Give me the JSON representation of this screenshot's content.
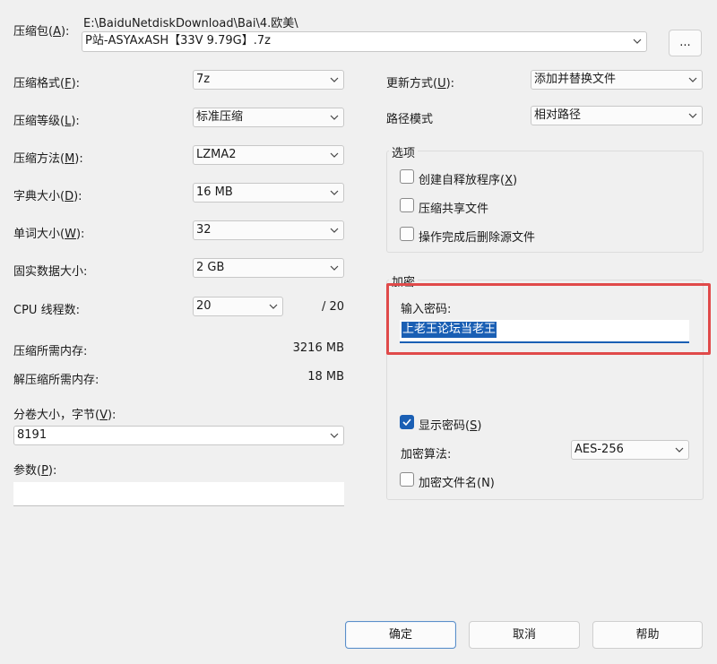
{
  "archive": {
    "label": "压缩包(",
    "accel": "A",
    "label_end": "):",
    "path": "E:\\BaiduNetdiskDownload\\Bai\\4.欧美\\",
    "filename": "P站-ASYAxASH【33V 9.79G】.7z",
    "browse_label": "..."
  },
  "left": {
    "format": {
      "label": "压缩格式(",
      "accel": "F",
      "end": "):",
      "value": "7z"
    },
    "level": {
      "label": "压缩等级(",
      "accel": "L",
      "end": "):",
      "value": "标准压缩"
    },
    "method": {
      "label": "压缩方法(",
      "accel": "M",
      "end": "):",
      "value": "LZMA2"
    },
    "dict": {
      "label": "字典大小(",
      "accel": "D",
      "end": "):",
      "value": "16 MB"
    },
    "word": {
      "label": "单词大小(",
      "accel": "W",
      "end": "):",
      "value": "32"
    },
    "solid": {
      "label": "固实数据大小:",
      "value": "2 GB"
    },
    "threads": {
      "label": "CPU 线程数:",
      "value": "20",
      "max": "/ 20"
    },
    "mem_compress": {
      "label": "压缩所需内存:",
      "value": "3216 MB"
    },
    "mem_decompress": {
      "label": "解压缩所需内存:",
      "value": "18 MB"
    },
    "volume": {
      "label": "分卷大小，字节(",
      "accel": "V",
      "end": "):",
      "value": "8191"
    },
    "params": {
      "label": "参数(",
      "accel": "P",
      "end": "):",
      "value": ""
    }
  },
  "right": {
    "update": {
      "label": "更新方式(",
      "accel": "U",
      "end": "):",
      "value": "添加并替换文件"
    },
    "pathmode": {
      "label": "路径模式",
      "value": "相对路径"
    },
    "options": {
      "title": "选项",
      "sfx": {
        "label": "创建自释放程序(",
        "accel": "X",
        "end": ")",
        "checked": false
      },
      "shared": {
        "label": "压缩共享文件",
        "checked": false
      },
      "delete": {
        "label": "操作完成后删除源文件",
        "checked": false
      }
    },
    "encryption": {
      "title": "加密",
      "password_label": "输入密码:",
      "password_value": "上老王论坛当老王",
      "show_password": {
        "label": "显示密码(",
        "accel": "S",
        "end": ")",
        "checked": true
      },
      "method_label": "加密算法:",
      "method_value": "AES-256",
      "encrypt_names": {
        "label": "加密文件名(N)",
        "checked": false
      }
    }
  },
  "buttons": {
    "ok": "确定",
    "cancel": "取消",
    "help": "帮助"
  },
  "colors": {
    "highlight_box": "#e04a4a",
    "selection": "#1a5fb4",
    "accent": "#1a5fb4"
  }
}
